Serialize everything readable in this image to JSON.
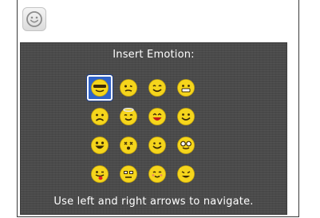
{
  "panel": {
    "title": "Insert Emotion:",
    "hint": "Use left and right arrows to navigate."
  },
  "toolbar": {
    "emoticon_button_icon": "smiley-icon"
  },
  "colors": {
    "panel_bg": "#4a4a4a",
    "emoji_yellow": "#f5d51c",
    "selection_blue": "#2f63c8"
  },
  "emoticons": [
    {
      "name": "cool-sunglasses",
      "selected": true
    },
    {
      "name": "confused"
    },
    {
      "name": "smile"
    },
    {
      "name": "grimace"
    },
    {
      "name": "sad"
    },
    {
      "name": "angel"
    },
    {
      "name": "laughing"
    },
    {
      "name": "grin"
    },
    {
      "name": "big-grin"
    },
    {
      "name": "dead"
    },
    {
      "name": "happy"
    },
    {
      "name": "nerd-glasses"
    },
    {
      "name": "tongue-out"
    },
    {
      "name": "worried"
    },
    {
      "name": "blush"
    },
    {
      "name": "devil"
    }
  ]
}
